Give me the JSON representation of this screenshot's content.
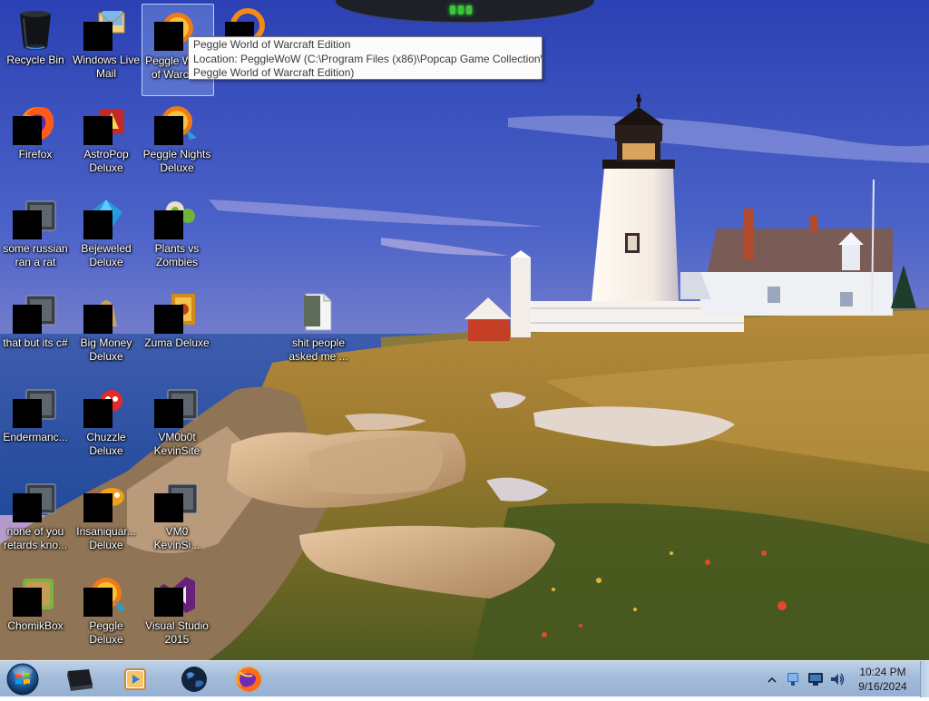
{
  "desktop": {
    "icons": [
      {
        "id": "recycle-bin",
        "label": "Recycle Bin",
        "redacted": false,
        "icon": "recycle-bin-icon"
      },
      {
        "id": "windows-live-mail",
        "label": "Windows Live\nMail",
        "redacted": true,
        "icon": "mail-icon"
      },
      {
        "id": "peggle-wow",
        "label": "Peggle World\nof Warcraft",
        "redacted": true,
        "selected": true,
        "icon": "peggle-icon"
      },
      {
        "id": "popcap-icon-4",
        "label": "",
        "redacted": true,
        "icon": "popcap-icon"
      },
      {
        "id": "firefox",
        "label": "Firefox",
        "redacted": true,
        "icon": "firefox-icon"
      },
      {
        "id": "astropop",
        "label": "AstroPop\nDeluxe",
        "redacted": true,
        "icon": "astropop-icon"
      },
      {
        "id": "peggle-nights",
        "label": "Peggle Nights\nDeluxe",
        "redacted": true,
        "icon": "peggle-icon"
      },
      {
        "id": "russian-rat",
        "label": "some russian\nran a rat",
        "redacted": true,
        "icon": "app-icon"
      },
      {
        "id": "bejeweled",
        "label": "Bejeweled\nDeluxe",
        "redacted": true,
        "icon": "bejeweled-icon"
      },
      {
        "id": "plants-vs-zombies",
        "label": "Plants vs\nZombies",
        "redacted": true,
        "icon": "plant-icon"
      },
      {
        "id": "that-but-csharp",
        "label": "that but its c#",
        "redacted": true,
        "icon": "app-icon"
      },
      {
        "id": "big-money",
        "label": "Big Money\nDeluxe",
        "redacted": true,
        "icon": "money-icon"
      },
      {
        "id": "zuma",
        "label": "Zuma Deluxe",
        "redacted": true,
        "icon": "zuma-icon"
      },
      {
        "id": "shit-people",
        "label": "shit people\nasked me ...",
        "redacted": false,
        "icon": "file-icon"
      },
      {
        "id": "enderman",
        "label": "Endermanc...",
        "redacted": true,
        "icon": "app-icon"
      },
      {
        "id": "chuzzle",
        "label": "Chuzzle\nDeluxe",
        "redacted": true,
        "icon": "chuzzle-icon"
      },
      {
        "id": "vm0b0t",
        "label": "VM0b0t\nKevinSite",
        "redacted": true,
        "icon": "app-icon"
      },
      {
        "id": "none-of-you",
        "label": "none of you\nretards kno...",
        "redacted": true,
        "icon": "app-icon"
      },
      {
        "id": "insaniquarium",
        "label": "Insaniquar...\nDeluxe",
        "redacted": true,
        "icon": "fish-icon"
      },
      {
        "id": "vm0-kevinsi",
        "label": "VM0\nKevinSi...",
        "redacted": true,
        "icon": "app-icon"
      },
      {
        "id": "chomikbox",
        "label": "ChomikBox",
        "redacted": true,
        "icon": "chomikbox-icon"
      },
      {
        "id": "peggle-deluxe",
        "label": "Peggle Deluxe",
        "redacted": true,
        "icon": "peggle-icon"
      },
      {
        "id": "visual-studio",
        "label": "Visual Studio\n2015",
        "redacted": true,
        "icon": "visual-studio-icon"
      }
    ]
  },
  "tooltip": {
    "line1": "Peggle World of Warcraft Edition",
    "line2": "Location: PeggleWoW (C:\\Program Files (x86)\\Popcap Game Collection\\",
    "line3": "Peggle World of Warcraft Edition)"
  },
  "taskbar": {
    "start_icon": "windows-orb-icon",
    "pinned": [
      "console-icon",
      "media-player-icon",
      "globe-icon",
      "firefox-icon"
    ],
    "tray_icons": [
      "show-hidden-chevron-icon",
      "network-icon",
      "monitor-icon",
      "volume-icon"
    ],
    "clock": {
      "time": "10:24 PM",
      "date": "9/16/2024"
    }
  },
  "colors": {
    "sky_top": "#2f46b8",
    "sky_bottom": "#b39ac8",
    "sea": "#2f56a8",
    "taskbar": "#a9c0dc",
    "gadget_green": "#39c639"
  }
}
